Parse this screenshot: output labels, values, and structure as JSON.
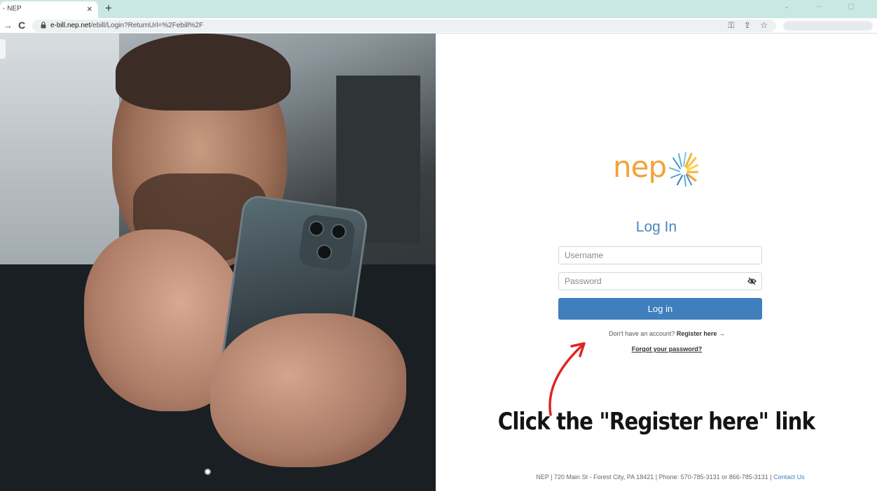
{
  "browser": {
    "tab_title": "- NEP",
    "tab_close": "×",
    "new_tab": "+",
    "window_controls": "⌄ – ▢",
    "nav_forward": "→",
    "nav_reload": "C",
    "url_host": "e-bill.nep.net",
    "url_path": "/ebill/Login?ReturnUrl=%2Febill%2F",
    "omnibox_icons": [
      "key-icon",
      "share-icon",
      "star-icon"
    ]
  },
  "login": {
    "logo_text": "nep",
    "title": "Log In",
    "username_placeholder": "Username",
    "password_placeholder": "Password",
    "login_button": "Log in",
    "no_account_text": "Don't have an account?",
    "register_link": "Register here →",
    "forgot_link": "Forgot your password?"
  },
  "annotation": {
    "text": "Click the \"Register here\" link",
    "arrow_color": "#e02424"
  },
  "footer": {
    "address": "NEP | 720 Main St - Forest City, PA 18421 | Phone: 570-785-3131 or 866-785-3131 |",
    "contact_link": "Contact Us"
  },
  "colors": {
    "accent_blue": "#3f7fbd",
    "title_blue": "#4a86c0",
    "logo_orange": "#f2a33a",
    "tabbar": "#c9e8e4"
  }
}
